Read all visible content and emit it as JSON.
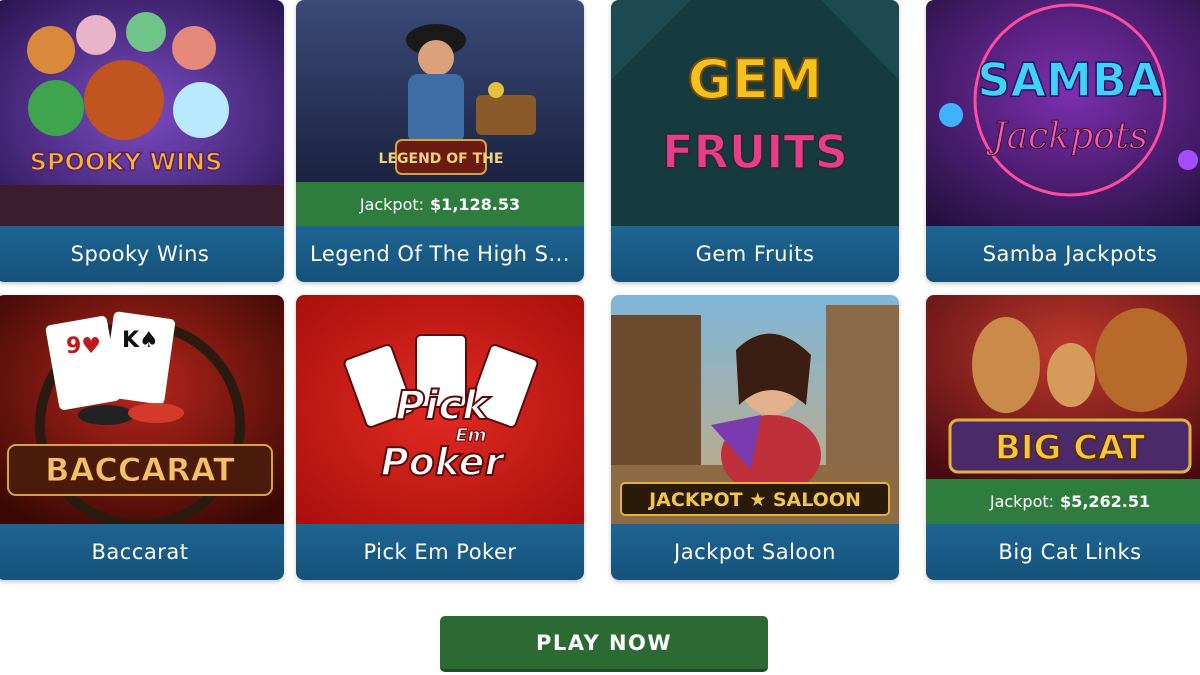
{
  "games": [
    {
      "name": "Spooky Wins",
      "logo": "SPOOKY WINS"
    },
    {
      "name": "Legend Of The High S...",
      "logo": "LEGEND OF THE",
      "jackpot_label": "Jackpot:",
      "jackpot_value": "$1,128.53"
    },
    {
      "name": "Gem Fruits",
      "logo_top": "GEM",
      "logo_bottom": "FRUITS"
    },
    {
      "name": "Samba Jackpots",
      "logo_top": "SAMBA",
      "logo_bottom": "Jackpots"
    },
    {
      "name": "Baccarat",
      "logo": "BACCARAT"
    },
    {
      "name": "Pick Em Poker",
      "logo_top": "Pick",
      "logo_mid": "Em",
      "logo_bottom": "Poker"
    },
    {
      "name": "Jackpot Saloon",
      "logo": "JACKPOT ★ SALOON"
    },
    {
      "name": "Big Cat Links",
      "logo": "BIG CAT",
      "jackpot_label": "Jackpot:",
      "jackpot_value": "$5,262.51"
    }
  ],
  "cta": {
    "label": "PLAY NOW"
  },
  "colors": {
    "name_bar": "#1d6593",
    "jackpot_bar": "#2f7d3e",
    "cta": "#2c6a34"
  }
}
